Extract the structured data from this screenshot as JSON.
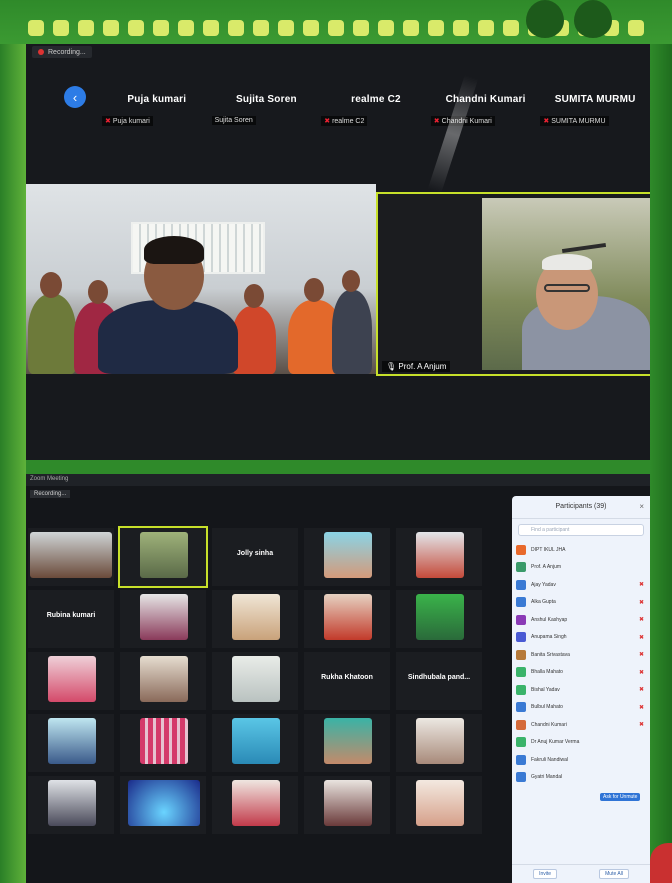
{
  "top_screen": {
    "recording_label": "Recording...",
    "participants_strip": [
      {
        "name": "Puja kumari",
        "label": "Puja kumari",
        "muted": true
      },
      {
        "name": "Sujita Soren",
        "label": "Sujita Soren",
        "muted": false
      },
      {
        "name": "realme C2",
        "label": "realme C2",
        "muted": true
      },
      {
        "name": "Chandni Kumari",
        "label": "Chandni Kumari",
        "muted": true
      },
      {
        "name": "SUMITA MURMU",
        "label": "SUMITA MURMU",
        "muted": true
      }
    ],
    "active_speaker": "Prof. A Anjum"
  },
  "bottom_screen": {
    "window_title": "Zoom Meeting",
    "recording_label": "Recording...",
    "grid_center_names": [
      "Jolly sinha",
      "Rubina kumari",
      "Rukha Khatoon",
      "Sindhubala pand..."
    ],
    "participants_panel": {
      "title": "Participants (39)",
      "search_placeholder": "Find a participant",
      "participants": [
        "DIPT IKUL JHA",
        "Prof. A Anjum",
        "Ajay Yadav",
        "Alka Gupta",
        "Anshul Kashyap",
        "Anupama Singh",
        "Banita Srivastava",
        "Bhalla Mahato",
        "Bishal Yadav",
        "Bulbul Mahato",
        "Chandni Kumari",
        "Dr Anuj Kumar Verma",
        "Fakruli Nandiwal",
        "Gyatri Mandal"
      ],
      "tooltip": "Ask for Unmute",
      "footer_buttons": [
        "Invite",
        "Mute All"
      ]
    }
  },
  "colors": {
    "frame_green": "#2f8a2a",
    "dot_yellow": "#d9ea6a",
    "active_border": "#c7e02a",
    "mute_red": "#dd3333"
  }
}
